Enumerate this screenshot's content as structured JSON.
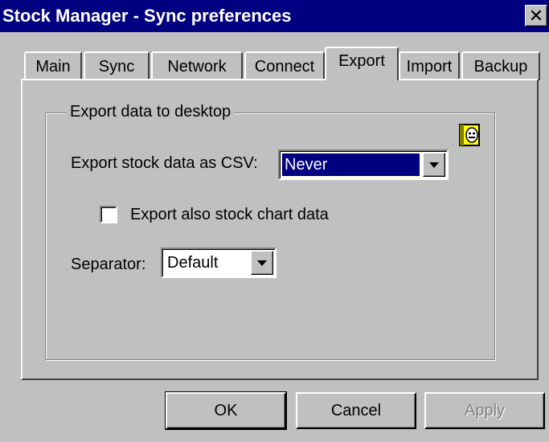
{
  "window": {
    "title": "Stock Manager - Sync preferences",
    "close_label": "✕"
  },
  "tabs": [
    {
      "label": "Main",
      "active": false
    },
    {
      "label": "Sync",
      "active": false
    },
    {
      "label": "Network",
      "active": false
    },
    {
      "label": "Connect",
      "active": false
    },
    {
      "label": "Export",
      "active": true
    },
    {
      "label": "Import",
      "active": false
    },
    {
      "label": "Backup",
      "active": false
    }
  ],
  "export": {
    "group_label": "Export data to desktop",
    "csv_label": "Export stock data as CSV:",
    "csv_value": "Never",
    "chart_checkbox_label": "Export also stock chart data",
    "chart_checkbox_checked": false,
    "separator_label": "Separator:",
    "separator_value": "Default",
    "help_icon": "help-book-icon"
  },
  "buttons": {
    "ok": "OK",
    "cancel": "Cancel",
    "apply": "Apply"
  },
  "colors": {
    "titlebar": "#000080",
    "face": "#c0c0c0",
    "selection": "#000080"
  }
}
